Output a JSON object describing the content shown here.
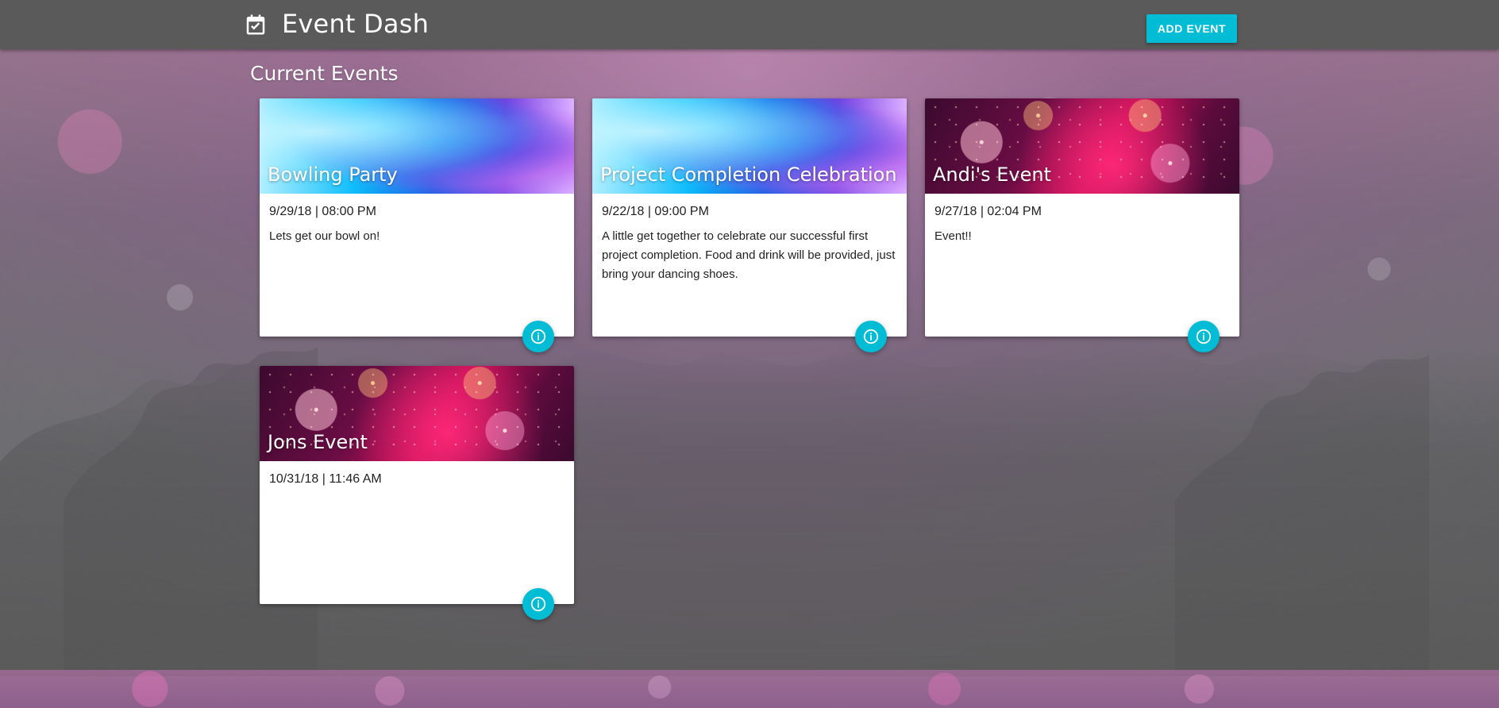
{
  "app": {
    "title": "Event Dash",
    "brand_icon": "calendar-check-icon",
    "add_event_label": "ADD EVENT",
    "accent": "#00bcd4",
    "appbar_bg": "#5a5a5a"
  },
  "main": {
    "section_title": "Current Events"
  },
  "events": [
    {
      "title": "Bowling Party",
      "datetime": "9/29/18 | 08:00 PM",
      "description": "Lets get our bowl on!",
      "media": "watercolor"
    },
    {
      "title": "Project Completion Celebration",
      "datetime": "9/22/18 | 09:00 PM",
      "description": "A little get together to celebrate our successful first project completion. Food and drink will be provided, just bring your dancing shoes.",
      "media": "watercolor"
    },
    {
      "title": "Andi's Event",
      "datetime": "9/27/18 | 02:04 PM",
      "description": "Event!!",
      "media": "fireworks"
    },
    {
      "title": "Jons Event",
      "datetime": "10/31/18 | 11:46 AM",
      "description": "",
      "media": "fireworks"
    }
  ],
  "icons": {
    "info": "info-icon"
  }
}
